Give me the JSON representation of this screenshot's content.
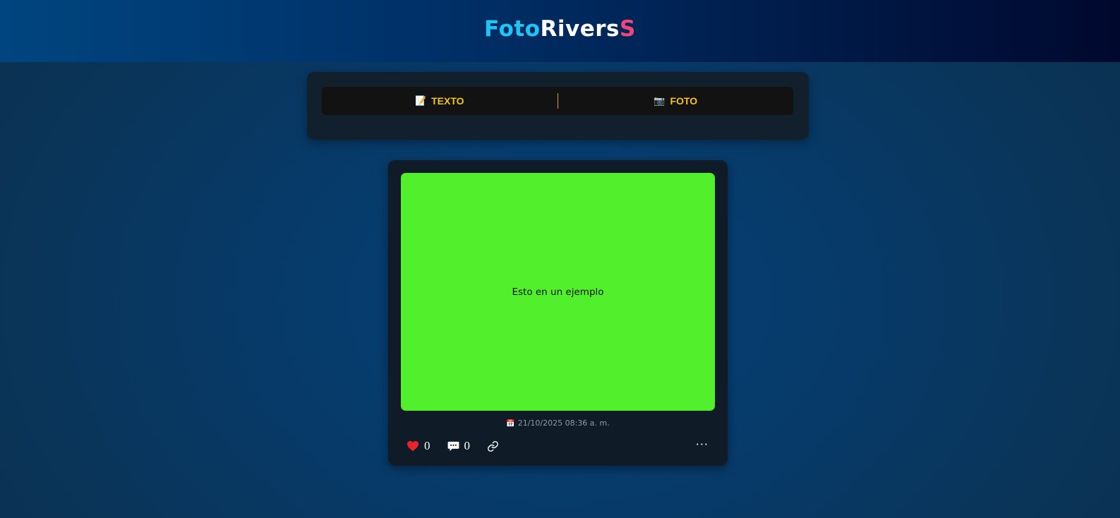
{
  "header": {
    "logo_part1": "Foto",
    "logo_part2": "Rivers",
    "logo_part3": "S",
    "colors": {
      "part1": "#1ec6f5",
      "part2": "#ffffff",
      "part3": "#f2457a"
    }
  },
  "composer": {
    "tabs": [
      {
        "icon": "memo-icon",
        "glyph": "📝",
        "label": "TEXTO"
      },
      {
        "icon": "camera-icon",
        "glyph": "📷",
        "label": "FOTO"
      }
    ],
    "accent": "#f5c518"
  },
  "post": {
    "image_text": "Esto en un ejemplo",
    "image_color": "#52ef2d",
    "date_icon": "calendar-icon",
    "date_glyph": "📅",
    "date": "21/10/2025 08:36 a. m.",
    "likes": "0",
    "comments": "0",
    "more_label": "···"
  }
}
